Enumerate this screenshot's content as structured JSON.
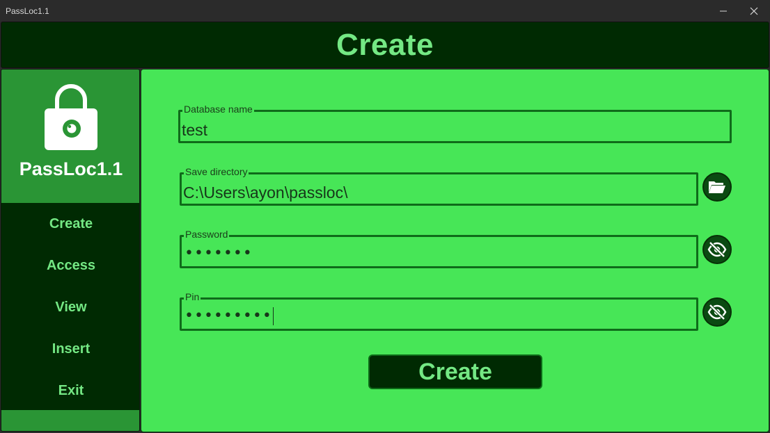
{
  "window": {
    "title": "PassLoc1.1",
    "minimize_icon": "minimize-icon",
    "close_icon": "close-icon"
  },
  "header": {
    "title": "Create"
  },
  "sidebar": {
    "logo_icon": "lock-icon",
    "brand_name": "PassLoc1.1",
    "items": [
      {
        "label": "Create"
      },
      {
        "label": "Access"
      },
      {
        "label": "View"
      },
      {
        "label": "Insert"
      },
      {
        "label": "Exit"
      }
    ]
  },
  "form": {
    "database_name": {
      "label": "Database name",
      "value": "test"
    },
    "save_directory": {
      "label": "Save directory",
      "value": "C:\\Users\\ayon\\passloc\\",
      "button_icon": "folder-open-icon"
    },
    "password": {
      "label": "Password",
      "masked_value": "•••••••",
      "button_icon": "eye-off-icon"
    },
    "pin": {
      "label": "Pin",
      "masked_value": "•••••••••",
      "button_icon": "eye-off-icon"
    },
    "submit_label": "Create"
  },
  "colors": {
    "header_bg": "#002a02",
    "accent_text": "#74e884",
    "brand_bg": "#2a9535",
    "form_bg": "#47e657",
    "field_border": "#0f6b1a"
  }
}
